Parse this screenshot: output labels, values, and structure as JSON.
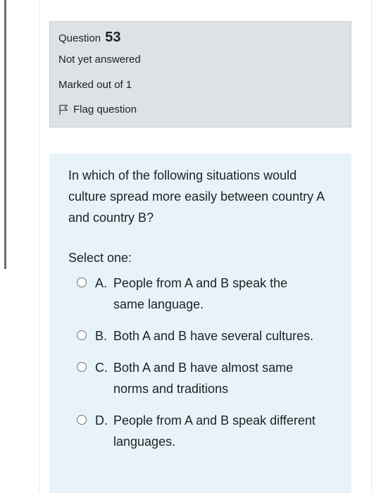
{
  "info": {
    "question_label": "Question",
    "question_number": "53",
    "state": "Not yet answered",
    "grade": "Marked out of 1",
    "flag_label": "Flag question"
  },
  "question": {
    "text": "In which of the following situations would culture spread more easily between country A and country B?",
    "prompt": "Select one:",
    "answers": [
      {
        "letter": "A.",
        "text": "People from A and B speak the same language.",
        "selected": false
      },
      {
        "letter": "B.",
        "text": "Both A and B have several cultures.",
        "selected": false
      },
      {
        "letter": "C.",
        "text": "Both A and B have almost same norms and traditions",
        "selected": false
      },
      {
        "letter": "D.",
        "text": "People from A and B speak different languages.",
        "selected": false
      }
    ]
  },
  "colors": {
    "info_background": "#dee2e6",
    "question_background": "#e7f3f8",
    "text": "#1d2125"
  },
  "icons": {
    "flag": "flag-outline-icon",
    "radio": "radio-unchecked-icon"
  }
}
